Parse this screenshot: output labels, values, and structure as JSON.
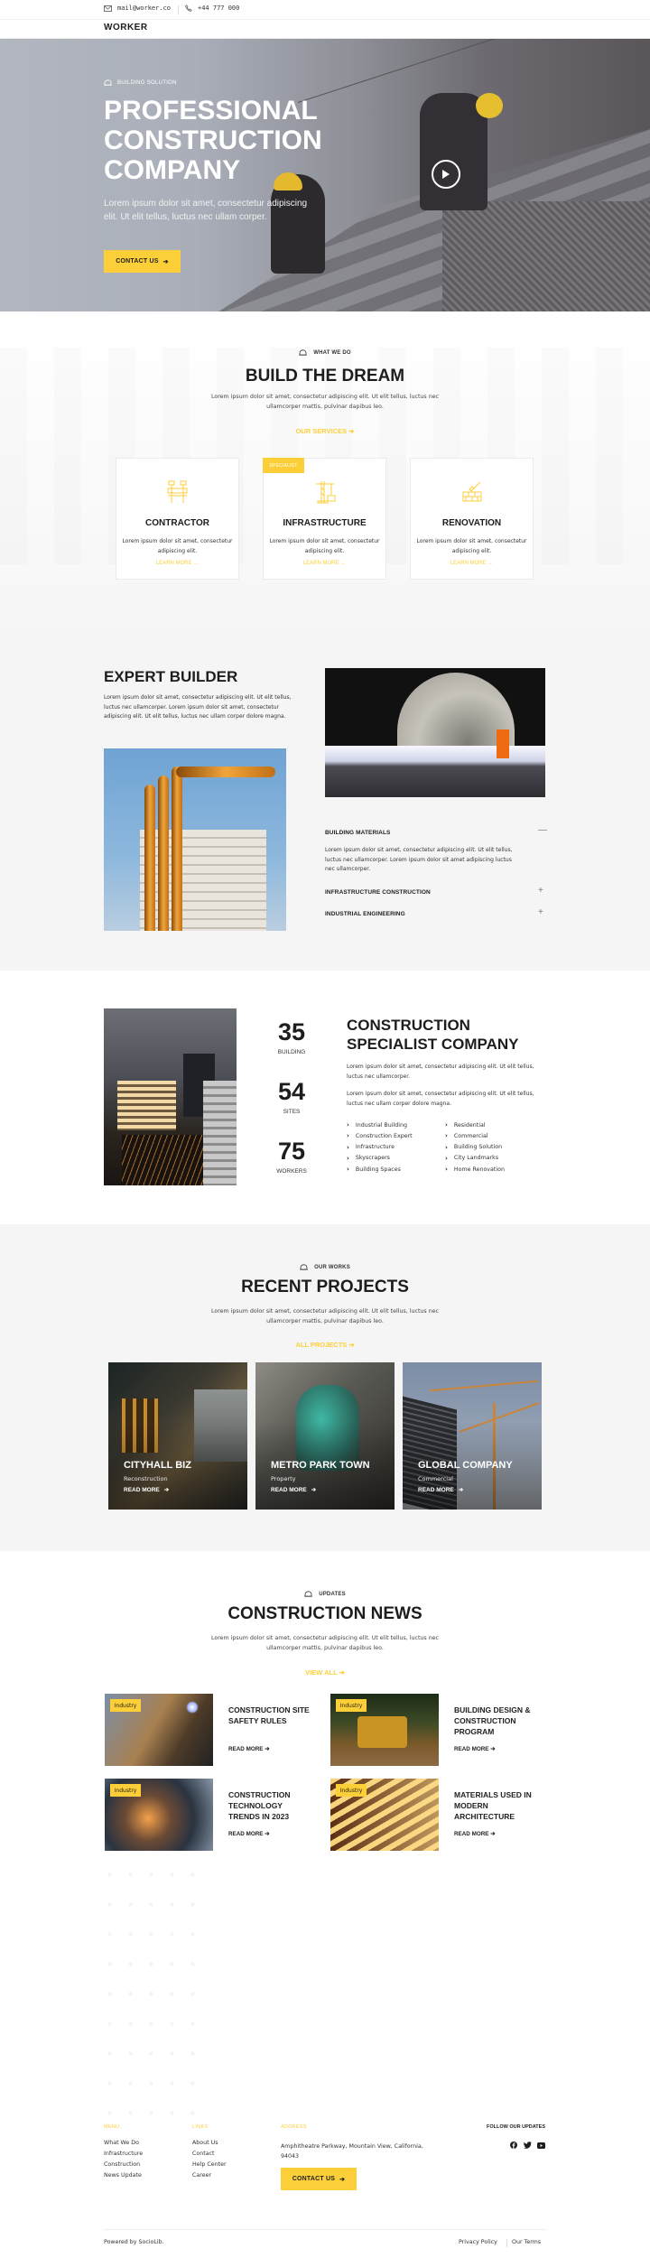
{
  "topbar": {
    "email": "mail@worker.co",
    "phone": "+44 777 000",
    "email_icon": "envelope-icon",
    "phone_icon": "phone-icon"
  },
  "header": {
    "logo": "WORKER"
  },
  "hero": {
    "eyebrow": "BUILDING SOLUTION",
    "title": "PROFESSIONAL CONSTRUCTION COMPANY",
    "subtitle": "Lorem ipsum dolor sit amet, consectetur adipiscing elit. Ut elit tellus, luctus nec ullam corper.",
    "cta": "CONTACT US",
    "play_icon": "play-icon"
  },
  "services": {
    "eyebrow": "WHAT WE DO",
    "title": "BUILD THE DREAM",
    "subtitle": "Lorem ipsum dolor sit amet, consectetur adipiscing elit. Ut elit tellus, luctus nec ullamcorper mattis, pulvinar dapibus leo.",
    "link": "OUR SERVICES",
    "badge": "SPECIALIST",
    "cards": [
      {
        "title": "CONTRACTOR",
        "text": "Lorem ipsum dolor sit amet, consectetur adipiscing elit.",
        "link": "LEARN MORE →",
        "icon": "barrier-icon"
      },
      {
        "title": "INFRASTRUCTURE",
        "text": "Lorem ipsum dolor sit amet, consectetur adipiscing elit.",
        "link": "LEARN MORE →",
        "icon": "crane-icon"
      },
      {
        "title": "RENOVATION",
        "text": "Lorem ipsum dolor sit amet, consectetur adipiscing elit.",
        "link": "LEARN MORE →",
        "icon": "brick-wall-icon"
      }
    ]
  },
  "expert": {
    "title": "EXPERT BUILDER",
    "text": "Lorem ipsum dolor sit amet, consectetur adipiscing elit. Ut elit tellus, luctus nec ullamcorper. Lorem ipsum dolor sit amet, consectetur adipiscing elit. Ut elit tellus, luctus nec ullam corper dolore magna.",
    "accordion": [
      {
        "title": "BUILDING MATERIALS",
        "open": true,
        "body": "Lorem ipsum dolor sit amet, consectetur adipiscing elit. Ut elit tellus, luctus nec ullamcorper. Lorem ipsum dolor sit amet adipiscing luctus nec ullamcorper."
      },
      {
        "title": "INFRASTRUCTURE CONSTRUCTION",
        "open": false
      },
      {
        "title": "INDUSTRIAL ENGINEERING",
        "open": false
      }
    ]
  },
  "stats": {
    "items": [
      {
        "value": "35",
        "label": "BUILDING"
      },
      {
        "value": "54",
        "label": "SITES"
      },
      {
        "value": "75",
        "label": "WORKERS"
      }
    ],
    "title": "CONSTRUCTION SPECIALIST COMPANY",
    "p1": "Lorem ipsum dolor sit amet, consectetur adipiscing elit. Ut elit tellus, luctus nec ullamcorper.",
    "p2": "Lorem ipsum dolor sit amet, consectetur adipiscing elit. Ut elit tellus, luctus nec ullam corper dolore magna.",
    "list_left": [
      "Industrial Building",
      "Construction Expert",
      "Infrastructure",
      "Skyscrapers",
      "Building Spaces"
    ],
    "list_right": [
      "Residential",
      "Commercial",
      "Building Solution",
      "City Landmarks",
      "Home Renovation"
    ]
  },
  "projects": {
    "eyebrow": "OUR WORKS",
    "title": "RECENT PROJECTS",
    "subtitle": "Lorem ipsum dolor sit amet, consectetur adipiscing elit. Ut elit tellus, luctus nec ullamcorper mattis, pulvinar dapibus leo.",
    "link": "ALL PROJECTS",
    "items": [
      {
        "title": "CITYHALL BIZ",
        "category": "Reconstruction",
        "link": "READ MORE"
      },
      {
        "title": "METRO PARK TOWN",
        "category": "Property",
        "link": "READ MORE"
      },
      {
        "title": "GLOBAL COMPANY",
        "category": "Commercial",
        "link": "READ MORE"
      }
    ]
  },
  "news": {
    "eyebrow": "UPDATES",
    "title": "CONSTRUCTION NEWS",
    "subtitle": "Lorem ipsum dolor sit amet, consectetur adipiscing elit. Ut elit tellus, luctus nec ullamcorper mattis, pulvinar dapibus leo.",
    "link": "VIEW ALL",
    "items": [
      {
        "tag": "Industry",
        "title": "CONSTRUCTION SITE SAFETY RULES",
        "link": "READ MORE"
      },
      {
        "tag": "Industry",
        "title": "BUILDING DESIGN & CONSTRUCTION PROGRAM",
        "link": "READ MORE"
      },
      {
        "tag": "Industry",
        "title": "CONSTRUCTION TECHNOLOGY TRENDS IN 2023",
        "link": "READ MORE"
      },
      {
        "tag": "Industry",
        "title": "MATERIALS USED IN MODERN ARCHITECTURE",
        "link": "READ MORE"
      }
    ]
  },
  "footer": {
    "menu_heading": "MENU",
    "menu": [
      "What We Do",
      "Infrastructure",
      "Construction",
      "News Update"
    ],
    "links_heading": "LINKS",
    "links": [
      "About Us",
      "Contact",
      "Help Center",
      "Career"
    ],
    "address_heading": "ADDRESS",
    "address": "Amphitheatre Parkway, Mountain View, California, 94043",
    "cta": "CONTACT US",
    "follow": "FOLLOW OUR UPDATES",
    "social": [
      "facebook-icon",
      "twitter-icon",
      "youtube-icon"
    ],
    "powered": "Powered by SocioLib.",
    "privacy": "Privacy Policy",
    "terms": "Our Terms"
  },
  "colors": {
    "accent": "#fccf38",
    "text": "#1d1d1d",
    "section_bg": "#f5f5f5"
  }
}
